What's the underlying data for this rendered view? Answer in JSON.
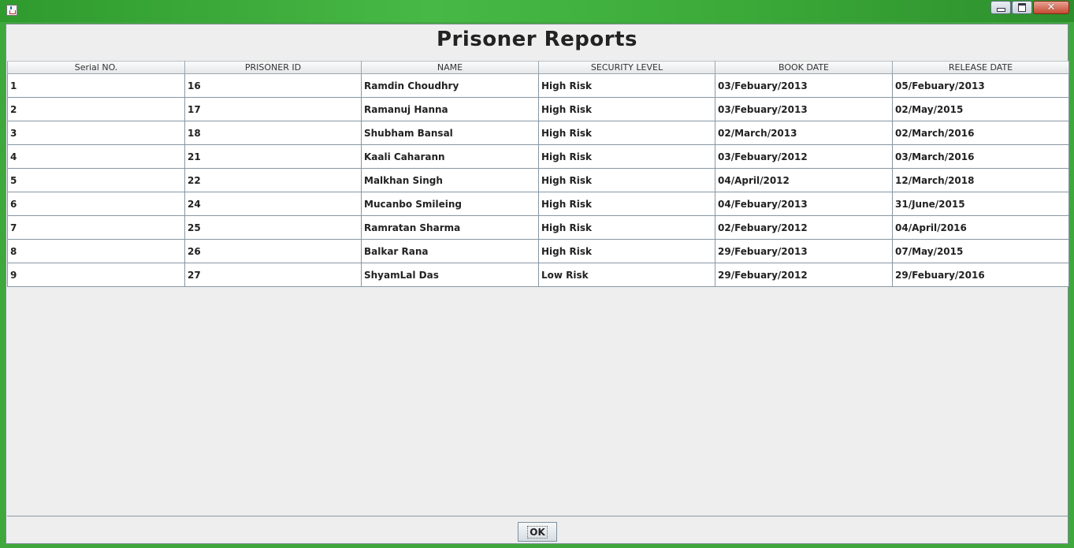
{
  "window": {
    "buttons": {
      "minimize": "minimize-icon",
      "maximize": "maximize-icon",
      "close": "close-icon"
    }
  },
  "title": "Prisoner Reports",
  "table": {
    "columns": [
      "Serial NO.",
      "PRISONER ID",
      "NAME",
      "SECURITY LEVEL",
      "BOOK DATE",
      "RELEASE DATE"
    ],
    "rows": [
      [
        "1",
        "16",
        "Ramdin Choudhry",
        "High Risk",
        "03/Febuary/2013",
        "05/Febuary/2013"
      ],
      [
        "2",
        "17",
        "Ramanuj Hanna",
        "High Risk",
        "03/Febuary/2013",
        "02/May/2015"
      ],
      [
        "3",
        "18",
        "Shubham Bansal",
        "High Risk",
        "02/March/2013",
        "02/March/2016"
      ],
      [
        "4",
        "21",
        "Kaali Caharann",
        "High Risk",
        "03/Febuary/2012",
        "03/March/2016"
      ],
      [
        "5",
        "22",
        "Malkhan Singh",
        "High Risk",
        "04/April/2012",
        "12/March/2018"
      ],
      [
        "6",
        "24",
        "Mucanbo Smileing",
        "High Risk",
        "04/Febuary/2013",
        "31/June/2015"
      ],
      [
        "7",
        "25",
        "Ramratan Sharma",
        "High Risk",
        "02/Febuary/2012",
        "04/April/2016"
      ],
      [
        "8",
        "26",
        "Balkar Rana",
        "High Risk",
        "29/Febuary/2013",
        "07/May/2015"
      ],
      [
        "9",
        "27",
        "ShyamLal Das",
        "Low Risk",
        "29/Febuary/2012",
        "29/Febuary/2016"
      ]
    ]
  },
  "ok_label": "OK"
}
